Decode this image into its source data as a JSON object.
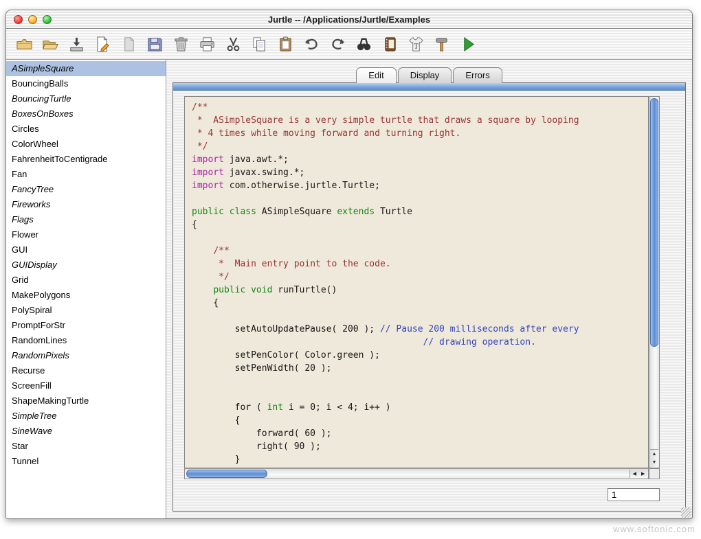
{
  "window": {
    "title": "Jurtle -- /Applications/Jurtle/Examples"
  },
  "toolbar": {
    "icons": [
      "new-folder",
      "open-folder",
      "import",
      "new-file",
      "file",
      "save",
      "trash",
      "print",
      "cut",
      "copy",
      "paste",
      "undo",
      "redo",
      "find",
      "notebook",
      "fonts",
      "build",
      "run"
    ]
  },
  "sidebar": {
    "items": [
      {
        "label": "ASimpleSquare",
        "italic": true,
        "selected": true
      },
      {
        "label": "BouncingBalls",
        "italic": false
      },
      {
        "label": "BouncingTurtle",
        "italic": true
      },
      {
        "label": "BoxesOnBoxes",
        "italic": true
      },
      {
        "label": "Circles",
        "italic": false
      },
      {
        "label": "ColorWheel",
        "italic": false
      },
      {
        "label": "FahrenheitToCentigrade",
        "italic": false
      },
      {
        "label": "Fan",
        "italic": false
      },
      {
        "label": "FancyTree",
        "italic": true
      },
      {
        "label": "Fireworks",
        "italic": true
      },
      {
        "label": "Flags",
        "italic": true
      },
      {
        "label": "Flower",
        "italic": false
      },
      {
        "label": "GUI",
        "italic": false
      },
      {
        "label": "GUIDisplay",
        "italic": true
      },
      {
        "label": "Grid",
        "italic": false
      },
      {
        "label": "MakePolygons",
        "italic": false
      },
      {
        "label": "PolySpiral",
        "italic": false
      },
      {
        "label": "PromptForStr",
        "italic": false
      },
      {
        "label": "RandomLines",
        "italic": false
      },
      {
        "label": "RandomPixels",
        "italic": true
      },
      {
        "label": "Recurse",
        "italic": false
      },
      {
        "label": "ScreenFill",
        "italic": false
      },
      {
        "label": "ShapeMakingTurtle",
        "italic": false
      },
      {
        "label": "SimpleTree",
        "italic": true
      },
      {
        "label": "SineWave",
        "italic": true
      },
      {
        "label": "Star",
        "italic": false
      },
      {
        "label": "Tunnel",
        "italic": false
      }
    ]
  },
  "tabs": {
    "items": [
      {
        "label": "Edit",
        "active": true
      },
      {
        "label": "Display",
        "active": false
      },
      {
        "label": "Errors",
        "active": false
      }
    ]
  },
  "editor": {
    "lines": [
      [
        [
          "c",
          "/**"
        ]
      ],
      [
        [
          "c",
          " *  ASimpleSquare is a very simple turtle that draws a square by looping"
        ]
      ],
      [
        [
          "c",
          " * 4 times while moving forward and turning right."
        ]
      ],
      [
        [
          "c",
          " */"
        ]
      ],
      [
        [
          "k",
          "import"
        ],
        [
          "p",
          " java.awt.*;"
        ]
      ],
      [
        [
          "k",
          "import"
        ],
        [
          "p",
          " javax.swing.*;"
        ]
      ],
      [
        [
          "k",
          "import"
        ],
        [
          "p",
          " com.otherwise.jurtle.Turtle;"
        ]
      ],
      [],
      [
        [
          "g",
          "public class"
        ],
        [
          "p",
          " ASimpleSquare "
        ],
        [
          "g",
          "extends"
        ],
        [
          "p",
          " Turtle"
        ]
      ],
      [
        [
          "p",
          "{"
        ]
      ],
      [],
      [
        [
          "p",
          "    "
        ],
        [
          "c",
          "/**"
        ]
      ],
      [
        [
          "p",
          "    "
        ],
        [
          "c",
          " *  Main entry point to the code."
        ]
      ],
      [
        [
          "p",
          "    "
        ],
        [
          "c",
          " */"
        ]
      ],
      [
        [
          "p",
          "    "
        ],
        [
          "g",
          "public void"
        ],
        [
          "p",
          " runTurtle()"
        ]
      ],
      [
        [
          "p",
          "    {"
        ]
      ],
      [],
      [
        [
          "p",
          "        setAutoUpdatePause( 200 ); "
        ],
        [
          "b",
          "// Pause 200 milliseconds after every"
        ]
      ],
      [
        [
          "p",
          "                                           "
        ],
        [
          "b",
          "// drawing operation."
        ]
      ],
      [
        [
          "p",
          "        setPenColor( Color.green );"
        ]
      ],
      [
        [
          "p",
          "        setPenWidth( 20 );"
        ]
      ],
      [],
      [],
      [
        [
          "p",
          "        for ( "
        ],
        [
          "g",
          "int"
        ],
        [
          "p",
          " i = 0; i < 4; i++ )"
        ]
      ],
      [
        [
          "p",
          "        {"
        ]
      ],
      [
        [
          "p",
          "            forward( 60 );"
        ]
      ],
      [
        [
          "p",
          "            right( 90 );"
        ]
      ],
      [
        [
          "p",
          "        }"
        ]
      ]
    ]
  },
  "footer": {
    "line_field_value": "1"
  },
  "glyphs": {
    "up": "▲",
    "down": "▼",
    "left": "◀",
    "right": "▶"
  },
  "colors": {
    "selection": "#ADC2E2",
    "editor_background": "#EFE9DB",
    "comment": "#993333",
    "import_keyword": "#AA22AA",
    "declaration_keyword": "#118811",
    "inline_comment": "#3344BB",
    "scrollbar_thumb": "#5B8ED6",
    "run_button": "#2F9E33",
    "traffic_red": "#F4433A",
    "traffic_yellow": "#F9B32F",
    "traffic_green": "#2FC440"
  },
  "watermark": "www.softonic.com"
}
